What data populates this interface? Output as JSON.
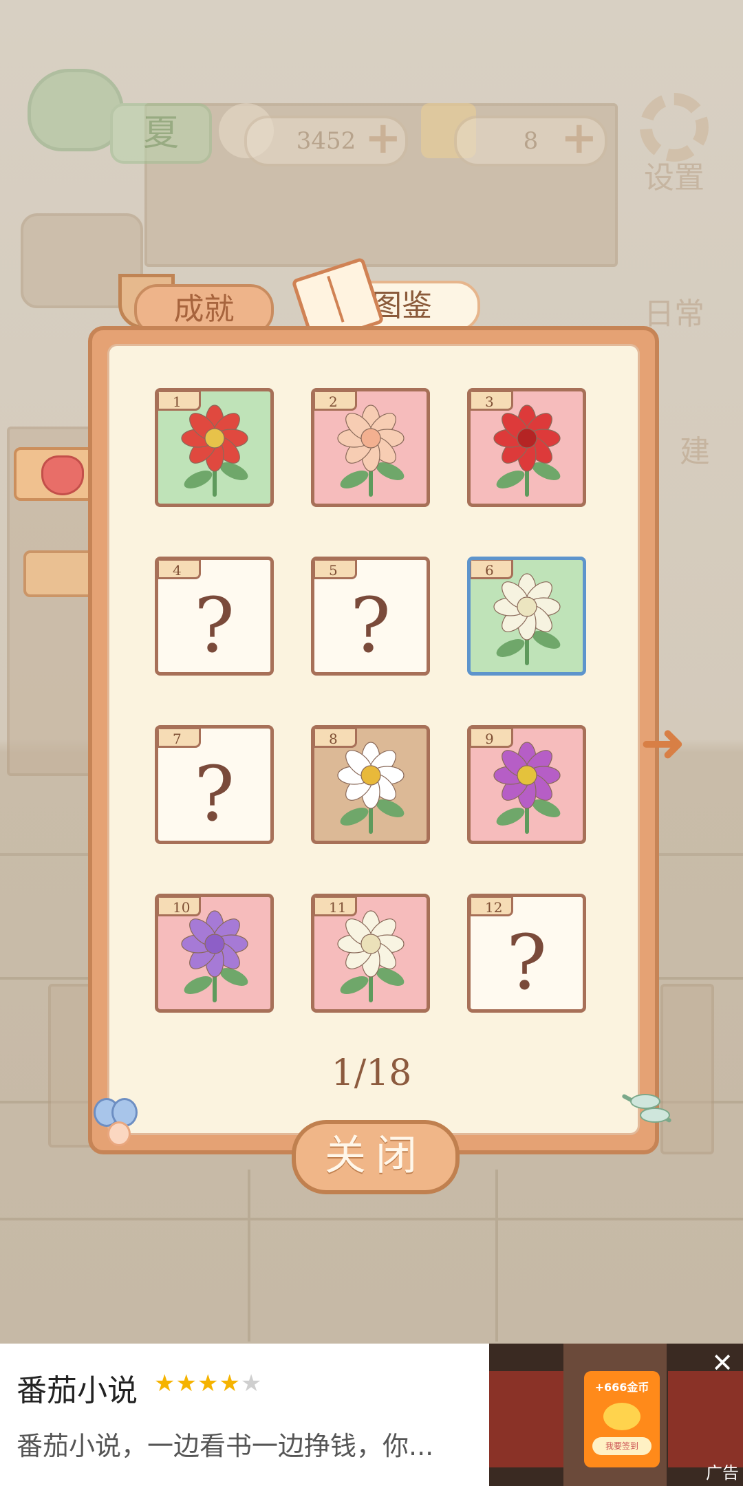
{
  "hud": {
    "season_label": "夏",
    "fish_count": "3452",
    "cheese_count": "8",
    "plus_symbol": "+",
    "settings_label": "设置",
    "daily_label": "日常",
    "build_label": "建"
  },
  "dialog": {
    "tabs": [
      {
        "label": "成就",
        "icon": "trophy-icon"
      },
      {
        "label": "图鉴",
        "icon": "book-icon"
      }
    ],
    "active_tab": "图鉴",
    "cards": [
      {
        "num": "1",
        "unlocked": true,
        "bg": "#bfe3b8",
        "petal": "#e0493f",
        "center": "#e7c24a",
        "icon": "protea-icon"
      },
      {
        "num": "2",
        "unlocked": true,
        "bg": "#f6bcbc",
        "petal": "#f7cdb3",
        "center": "#f3b090",
        "icon": "peony-rose-icon"
      },
      {
        "num": "3",
        "unlocked": true,
        "bg": "#f6bcbc",
        "petal": "#dd3a3a",
        "center": "#b52424",
        "icon": "red-rose-icon"
      },
      {
        "num": "4",
        "unlocked": false,
        "symbol": "?"
      },
      {
        "num": "5",
        "unlocked": false,
        "symbol": "?"
      },
      {
        "num": "6",
        "unlocked": true,
        "bg": "#bfe3b8",
        "petal": "#f6f3e0",
        "center": "#ece5c0",
        "icon": "gardenia-icon",
        "highlight": true
      },
      {
        "num": "7",
        "unlocked": false,
        "symbol": "?"
      },
      {
        "num": "8",
        "unlocked": true,
        "bg": "#dcb996",
        "petal": "#ffffff",
        "center": "#e8b93a",
        "icon": "daisy-icon"
      },
      {
        "num": "9",
        "unlocked": true,
        "bg": "#f6bcbc",
        "petal": "#b65ec6",
        "center": "#e4c23c",
        "icon": "cosmos-icon"
      },
      {
        "num": "10",
        "unlocked": true,
        "bg": "#f6bcbc",
        "petal": "#a67ad6",
        "center": "#8d5fc7",
        "icon": "lilac-icon"
      },
      {
        "num": "11",
        "unlocked": true,
        "bg": "#f6bcbc",
        "petal": "#f8f4e2",
        "center": "#ebe1b9",
        "icon": "white-peony-icon"
      },
      {
        "num": "12",
        "unlocked": false,
        "symbol": "?"
      }
    ],
    "page_count": "1/18",
    "next_symbol": "➜",
    "close_label": "关闭"
  },
  "ad": {
    "title": "番茄小说",
    "rating_filled": "★★★★",
    "rating_empty": "★",
    "description": "番茄小说，一边看书一边挣钱，你...",
    "promo_text": "+666金币",
    "promo_button": "我要签到",
    "close_symbol": "✕",
    "tag": "广告"
  },
  "colors": {
    "panel": "#e5a274",
    "panel_inner": "#fbf3df",
    "card_border": "#a77058",
    "card_highlight": "#5d94cc",
    "text_brown": "#8c5a3e"
  }
}
